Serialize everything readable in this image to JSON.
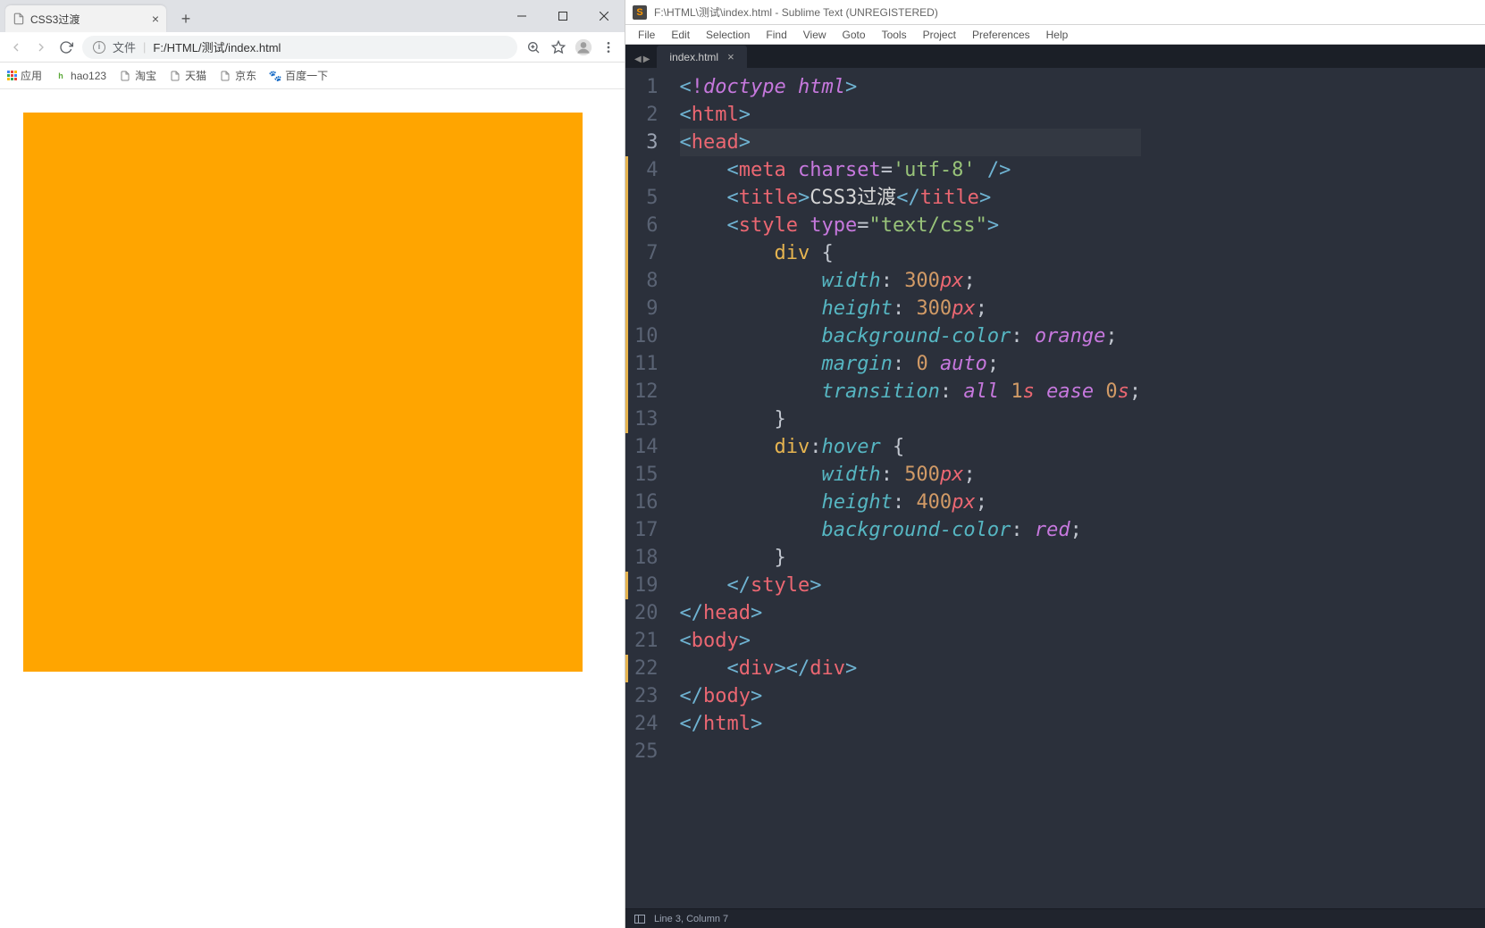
{
  "chrome": {
    "tab": {
      "title": "CSS3过渡"
    },
    "omnibox": {
      "label": "文件",
      "path": "F:/HTML/测试/index.html"
    },
    "bookmarks": [
      {
        "label": "应用",
        "icon": "apps"
      },
      {
        "label": "hao123",
        "icon": "hao"
      },
      {
        "label": "淘宝",
        "icon": "doc"
      },
      {
        "label": "天猫",
        "icon": "doc"
      },
      {
        "label": "京东",
        "icon": "doc"
      },
      {
        "label": "百度一下",
        "icon": "paw"
      }
    ]
  },
  "sublime": {
    "title": "F:\\HTML\\测试\\index.html - Sublime Text (UNREGISTERED)",
    "menu": [
      "File",
      "Edit",
      "Selection",
      "Find",
      "View",
      "Goto",
      "Tools",
      "Project",
      "Preferences",
      "Help"
    ],
    "tab": "index.html",
    "status": "Line 3, Column 7",
    "active_line": 3,
    "code_lines": 25,
    "code": {
      "l1": [
        [
          "<",
          "punct"
        ],
        [
          "!",
          "doctype"
        ],
        [
          "doctype html",
          "htmlkw"
        ],
        [
          ">",
          "punct"
        ]
      ],
      "l2": [
        [
          "<",
          "punct"
        ],
        [
          "html",
          "tag"
        ],
        [
          ">",
          "punct"
        ]
      ],
      "l3": [
        [
          "<",
          "punct"
        ],
        [
          "head",
          "tag"
        ],
        [
          ">",
          "punct"
        ]
      ],
      "l4": [
        [
          "    <",
          "punct"
        ],
        [
          "meta",
          "tag"
        ],
        [
          " ",
          "white"
        ],
        [
          "charset",
          "attrname"
        ],
        [
          "=",
          "white"
        ],
        [
          "'utf-8'",
          "str"
        ],
        [
          " />",
          "punct"
        ]
      ],
      "l5": [
        [
          "    <",
          "punct"
        ],
        [
          "title",
          "tag"
        ],
        [
          ">",
          "punct"
        ],
        [
          "CSS3过渡",
          "text"
        ],
        [
          "</",
          "punct"
        ],
        [
          "title",
          "tag"
        ],
        [
          ">",
          "punct"
        ]
      ],
      "l6": [
        [
          "    <",
          "punct"
        ],
        [
          "style",
          "tag"
        ],
        [
          " ",
          "white"
        ],
        [
          "type",
          "attrname"
        ],
        [
          "=",
          "white"
        ],
        [
          "\"text/css\"",
          "str"
        ],
        [
          ">",
          "punct"
        ]
      ],
      "l7": [
        [
          "        ",
          "white"
        ],
        [
          "div",
          "sel"
        ],
        [
          " {",
          "brace"
        ]
      ],
      "l8": [
        [
          "            ",
          "white"
        ],
        [
          "width",
          "prop"
        ],
        [
          ": ",
          "white"
        ],
        [
          "300",
          "num"
        ],
        [
          "px",
          "unit"
        ],
        [
          ";",
          "white"
        ]
      ],
      "l9": [
        [
          "            ",
          "white"
        ],
        [
          "height",
          "prop"
        ],
        [
          ": ",
          "white"
        ],
        [
          "300",
          "num"
        ],
        [
          "px",
          "unit"
        ],
        [
          ";",
          "white"
        ]
      ],
      "l10": [
        [
          "            ",
          "white"
        ],
        [
          "background-color",
          "prop"
        ],
        [
          ": ",
          "white"
        ],
        [
          "orange",
          "kw"
        ],
        [
          ";",
          "white"
        ]
      ],
      "l11": [
        [
          "            ",
          "white"
        ],
        [
          "margin",
          "prop"
        ],
        [
          ": ",
          "white"
        ],
        [
          "0",
          "num"
        ],
        [
          " ",
          "white"
        ],
        [
          "auto",
          "kw"
        ],
        [
          ";",
          "white"
        ]
      ],
      "l12": [
        [
          "            ",
          "white"
        ],
        [
          "transition",
          "prop"
        ],
        [
          ": ",
          "white"
        ],
        [
          "all",
          "kw"
        ],
        [
          " ",
          "white"
        ],
        [
          "1",
          "num"
        ],
        [
          "s",
          "unit"
        ],
        [
          " ",
          "white"
        ],
        [
          "ease",
          "kw"
        ],
        [
          " ",
          "white"
        ],
        [
          "0",
          "num"
        ],
        [
          "s",
          "unit"
        ],
        [
          ";",
          "white"
        ]
      ],
      "l13": [
        [
          "        }",
          "brace"
        ]
      ],
      "l14": [
        [
          "        ",
          "white"
        ],
        [
          "div",
          "sel"
        ],
        [
          ":",
          "white"
        ],
        [
          "hover",
          "pseudo"
        ],
        [
          " {",
          "brace"
        ]
      ],
      "l15": [
        [
          "            ",
          "white"
        ],
        [
          "width",
          "prop"
        ],
        [
          ": ",
          "white"
        ],
        [
          "500",
          "num"
        ],
        [
          "px",
          "unit"
        ],
        [
          ";",
          "white"
        ]
      ],
      "l16": [
        [
          "            ",
          "white"
        ],
        [
          "height",
          "prop"
        ],
        [
          ": ",
          "white"
        ],
        [
          "400",
          "num"
        ],
        [
          "px",
          "unit"
        ],
        [
          ";",
          "white"
        ]
      ],
      "l17": [
        [
          "            ",
          "white"
        ],
        [
          "background-color",
          "prop"
        ],
        [
          ": ",
          "white"
        ],
        [
          "red",
          "kw"
        ],
        [
          ";",
          "white"
        ]
      ],
      "l18": [
        [
          "        }",
          "brace"
        ]
      ],
      "l19": [
        [
          "    </",
          "punct"
        ],
        [
          "style",
          "tag"
        ],
        [
          ">",
          "punct"
        ]
      ],
      "l20": [
        [
          "</",
          "punct"
        ],
        [
          "head",
          "tag"
        ],
        [
          ">",
          "punct"
        ]
      ],
      "l21": [
        [
          "<",
          "punct"
        ],
        [
          "body",
          "tag"
        ],
        [
          ">",
          "punct"
        ]
      ],
      "l22": [
        [
          "    <",
          "punct"
        ],
        [
          "div",
          "tag"
        ],
        [
          "></",
          "punct"
        ],
        [
          "div",
          "tag"
        ],
        [
          ">",
          "punct"
        ]
      ],
      "l23": [
        [
          "</",
          "punct"
        ],
        [
          "body",
          "tag"
        ],
        [
          ">",
          "punct"
        ]
      ],
      "l24": [
        [
          "</",
          "punct"
        ],
        [
          "html",
          "tag"
        ],
        [
          ">",
          "punct"
        ]
      ],
      "l25": [
        [
          "",
          "white"
        ]
      ]
    },
    "markers": [
      4,
      5,
      6,
      7,
      8,
      9,
      10,
      11,
      12,
      13,
      19,
      22
    ]
  }
}
